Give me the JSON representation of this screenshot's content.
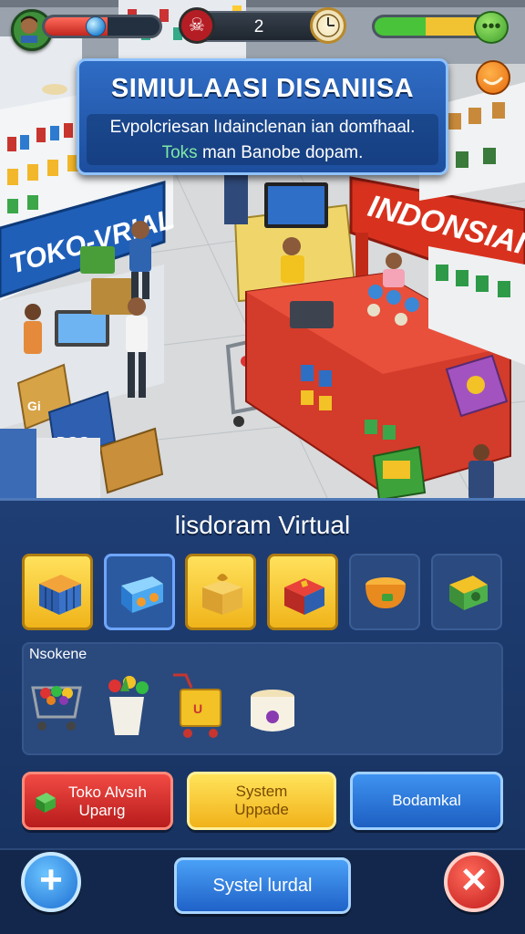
{
  "hud": {
    "health_level": 0.55,
    "counter_value": "2",
    "energy_level": 0.9,
    "icons": [
      "avatar",
      "skull-icon",
      "clock-icon",
      "chat-icon",
      "orange-coin-icon"
    ]
  },
  "info_panel": {
    "title": "SIMIULAASI DISANIISA",
    "line1": "Evpolcriesan lıdainclenan ian domfhaal.",
    "line2_highlight": "Toks",
    "line2_rest": " man Banobe dopam."
  },
  "store_signs": {
    "left": "TOKO-VRIAL",
    "right": "INDONSIAI",
    "box_label": "Gi",
    "box_label2": "ĐGG"
  },
  "panel": {
    "title": "lisdoram Virtual",
    "tiles": [
      {
        "icon": "blue-crate-icon",
        "style": "yellow"
      },
      {
        "icon": "radio-box-icon",
        "style": "blue-selected"
      },
      {
        "icon": "gift-box-icon",
        "style": "yellow"
      },
      {
        "icon": "red-box-icon",
        "style": "yellow"
      },
      {
        "icon": "bowl-icon",
        "style": "blue"
      },
      {
        "icon": "cash-stack-icon",
        "style": "blue"
      }
    ],
    "section_label": "Nsokene",
    "items": [
      {
        "icon": "shopping-cart-icon"
      },
      {
        "icon": "produce-bucket-icon"
      },
      {
        "icon": "yellow-cart-icon",
        "text": "U"
      },
      {
        "icon": "jar-icon"
      }
    ]
  },
  "buttons": {
    "red_line1": "Toko Alvsıh",
    "red_line2": "Uparıg",
    "yellow_line1": "System",
    "yellow_line2": "Uppade",
    "blue": "Bodamkal"
  },
  "bottom_bar": {
    "add_symbol": "+",
    "main_label": "Systel lurdal",
    "close_symbol": "✕"
  },
  "colors": {
    "panel_bg": "#1f3e74",
    "red_button": "#d62a26",
    "yellow_button": "#f6c22a",
    "blue_button": "#2f7ae0",
    "sign_red": "#d8321e",
    "sign_blue": "#1f5fb8"
  }
}
